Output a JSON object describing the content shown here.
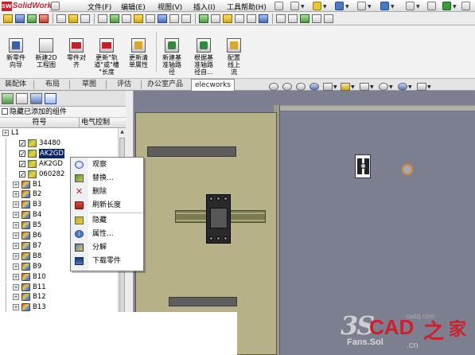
{
  "app": {
    "logo_text": "SolidWorks",
    "logo_mark": "SW"
  },
  "menubar": {
    "items": [
      "文件(F)",
      "编辑(E)",
      "视图(V)",
      "插入(I)",
      "工具",
      "帮助(H)"
    ]
  },
  "ribbon": {
    "buttons": [
      {
        "label": "新零件\n向导",
        "icon": "new-part-wizard-icon"
      },
      {
        "label": "新建2D\n工程图",
        "icon": "new-2d-drawing-icon"
      },
      {
        "label": "零件对\n齐",
        "icon": "part-align-icon"
      },
      {
        "label": "更新\"轨\n道\"或\"槽\n\"长度",
        "icon": "update-rail-length-icon"
      },
      {
        "label": "更新清\n单属性",
        "icon": "update-bom-property-icon"
      },
      {
        "label": "新建基\n准轴路\n径",
        "icon": "new-datum-axis-path-icon"
      },
      {
        "label": "根据基\n准轴路\n径自...",
        "icon": "auto-from-datum-path-icon"
      },
      {
        "label": "配置\n线上\n流",
        "icon": "configure-line-icon"
      }
    ]
  },
  "tabs": [
    {
      "label": "装配体",
      "active": false
    },
    {
      "label": "布局",
      "active": false
    },
    {
      "label": "草图",
      "active": false
    },
    {
      "label": "评估",
      "active": false
    },
    {
      "label": "办公室产品",
      "active": false
    },
    {
      "label": "elecworks",
      "active": true
    }
  ],
  "feature_manager": {
    "hide_added_label": "隐藏已添加的组件",
    "col_symbol": "符号",
    "col_elec": "电气控制",
    "rows": [
      {
        "indent": 0,
        "expander": "+",
        "check": false,
        "icon": "folder",
        "text": "L1",
        "selected": false
      },
      {
        "indent": 1,
        "expander": "",
        "check": true,
        "icon": "cube",
        "text": "34480",
        "selected": false
      },
      {
        "indent": 1,
        "expander": "",
        "check": true,
        "icon": "cube",
        "text": "AK2GD",
        "selected": true
      },
      {
        "indent": 1,
        "expander": "",
        "check": true,
        "icon": "cube",
        "text": "AK2GD",
        "selected": false
      },
      {
        "indent": 1,
        "expander": "",
        "check": true,
        "icon": "cube",
        "text": "060282",
        "selected": false
      },
      {
        "indent": 1,
        "expander": "+",
        "check": false,
        "icon": "multi",
        "text": "B1",
        "selected": false
      },
      {
        "indent": 1,
        "expander": "+",
        "check": false,
        "icon": "multi",
        "text": "B2",
        "selected": false
      },
      {
        "indent": 1,
        "expander": "+",
        "check": false,
        "icon": "multi",
        "text": "B3",
        "selected": false
      },
      {
        "indent": 1,
        "expander": "+",
        "check": false,
        "icon": "multi",
        "text": "B4",
        "selected": false
      },
      {
        "indent": 1,
        "expander": "+",
        "check": false,
        "icon": "multi",
        "text": "B5",
        "selected": false
      },
      {
        "indent": 1,
        "expander": "+",
        "check": false,
        "icon": "multi",
        "text": "B6",
        "selected": false
      },
      {
        "indent": 1,
        "expander": "+",
        "check": false,
        "icon": "multi",
        "text": "B7",
        "selected": false
      },
      {
        "indent": 1,
        "expander": "+",
        "check": false,
        "icon": "multi",
        "text": "B8",
        "selected": false
      },
      {
        "indent": 1,
        "expander": "+",
        "check": false,
        "icon": "multi",
        "text": "B9",
        "selected": false
      },
      {
        "indent": 1,
        "expander": "+",
        "check": false,
        "icon": "multi",
        "text": "B10",
        "selected": false
      },
      {
        "indent": 1,
        "expander": "+",
        "check": false,
        "icon": "multi",
        "text": "B11",
        "selected": false
      },
      {
        "indent": 1,
        "expander": "+",
        "check": false,
        "icon": "multi",
        "text": "B12",
        "selected": false
      },
      {
        "indent": 1,
        "expander": "+",
        "check": false,
        "icon": "multi",
        "text": "B13",
        "selected": false
      }
    ]
  },
  "context_menu": {
    "items": [
      {
        "label": "观察",
        "icon": "view"
      },
      {
        "label": "替换...",
        "icon": "swap"
      },
      {
        "label": "删除",
        "icon": "del"
      },
      {
        "label": "刷新长度",
        "icon": "len"
      },
      {
        "label": "隐藏",
        "icon": "hide"
      },
      {
        "label": "属性...",
        "icon": "prop"
      },
      {
        "label": "分解",
        "icon": "split"
      },
      {
        "label": "下载零件",
        "icon": "dl"
      }
    ]
  },
  "watermark": {
    "brand": "CAD之家",
    "cad": "CAD",
    "zhi": "之",
    "jia": "家",
    "site": ".cn",
    "fans": "Fans.Sol",
    "ds": "3S",
    "domain": "cadzj.com"
  },
  "colors": {
    "selection": "#0a246a",
    "panel_sheet": "#b6b186",
    "graphics_bg": "#7b7f8f",
    "brand_red": "#d21e2a"
  }
}
